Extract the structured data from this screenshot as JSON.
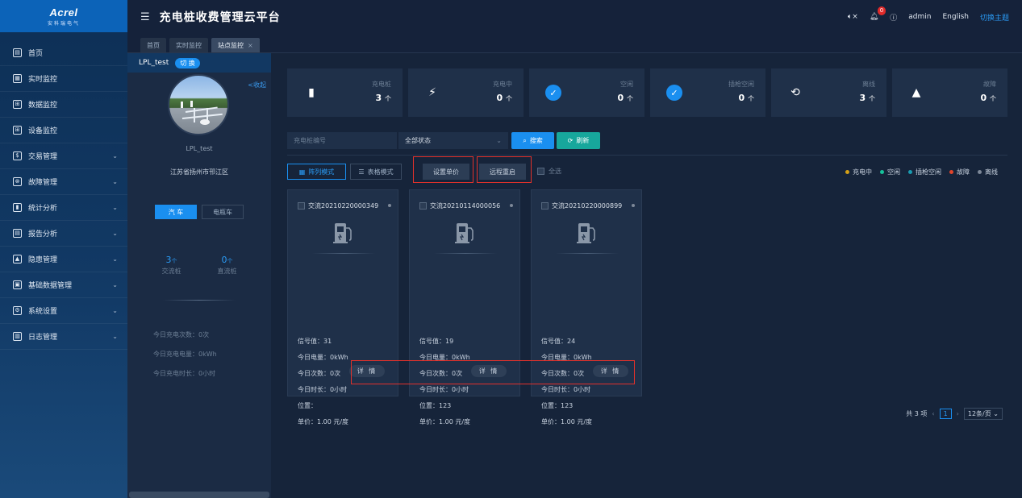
{
  "logo": {
    "brand": "Acrel",
    "sub": "安科瑞电气"
  },
  "sidebar": {
    "items": [
      {
        "label": "首页",
        "icon": "home-icon",
        "glyph": "▤",
        "chev": ""
      },
      {
        "label": "实时监控",
        "icon": "monitor-icon",
        "glyph": "▦",
        "chev": ""
      },
      {
        "label": "数据监控",
        "icon": "data-icon",
        "glyph": "⊞",
        "chev": ""
      },
      {
        "label": "设备监控",
        "icon": "device-icon",
        "glyph": "⊞",
        "chev": ""
      },
      {
        "label": "交易管理",
        "icon": "money-icon",
        "glyph": "$",
        "chev": "⌄"
      },
      {
        "label": "故障管理",
        "icon": "fault-icon",
        "glyph": "⊗",
        "chev": "⌄"
      },
      {
        "label": "统计分析",
        "icon": "stats-icon",
        "glyph": "▮",
        "chev": "⌄"
      },
      {
        "label": "报告分析",
        "icon": "report-icon",
        "glyph": "▤",
        "chev": "⌄"
      },
      {
        "label": "隐患管理",
        "icon": "warning-icon",
        "glyph": "▲",
        "chev": "⌄"
      },
      {
        "label": "基础数据管理",
        "icon": "basedata-icon",
        "glyph": "▣",
        "chev": "⌄"
      },
      {
        "label": "系统设置",
        "icon": "settings-icon",
        "glyph": "⚙",
        "chev": "⌄"
      },
      {
        "label": "日志管理",
        "icon": "log-icon",
        "glyph": "▥",
        "chev": "⌄"
      }
    ]
  },
  "header": {
    "title": "充电桩收费管理云平台",
    "badge_count": "0",
    "user": "admin",
    "language": "English",
    "theme_link": "切换主题"
  },
  "tabs": [
    {
      "label": "首页",
      "active": false
    },
    {
      "label": "实时监控",
      "active": false
    },
    {
      "label": "站点监控",
      "active": true
    }
  ],
  "station": {
    "name": "LPL_test",
    "switch_label": "切 换",
    "collapse_label": "<收起",
    "address": "江苏省扬州市邗江区",
    "vehicle_tabs": [
      "汽 车",
      "电瓶车"
    ],
    "counts": [
      {
        "num": "3",
        "unit": "个",
        "label": "交流桩"
      },
      {
        "num": "0",
        "unit": "个",
        "label": "直流桩"
      }
    ],
    "today_count": "今日充电次数：0次",
    "today_energy": "今日充电电量：0kWh",
    "today_duration": "今日充电时长：0小时"
  },
  "stats": [
    {
      "label": "充电桩",
      "value": "3",
      "unit": "个",
      "icon": "charger-icon"
    },
    {
      "label": "充电中",
      "value": "0",
      "unit": "个",
      "icon": "lightning-icon"
    },
    {
      "label": "空闲",
      "value": "0",
      "unit": "个",
      "icon": "idle-check-icon"
    },
    {
      "label": "插枪空闲",
      "value": "0",
      "unit": "个",
      "icon": "plug-check-icon"
    },
    {
      "label": "离线",
      "value": "3",
      "unit": "个",
      "icon": "offline-plug-icon"
    },
    {
      "label": "故障",
      "value": "0",
      "unit": "个",
      "icon": "fault-warning-icon"
    }
  ],
  "filter": {
    "placeholder": "充电桩编号",
    "status_value": "全部状态",
    "search_label": "搜索",
    "refresh_label": "刷新"
  },
  "actions": {
    "grid_mode": "阵列模式",
    "table_mode": "表格模式",
    "set_price": "设置单价",
    "remote_reboot": "远程重启",
    "select_all": "全选"
  },
  "legend": [
    {
      "label": "充电中",
      "color": "#d4a017"
    },
    {
      "label": "空闲",
      "color": "#17c29b"
    },
    {
      "label": "插枪空闲",
      "color": "#1a9bb0"
    },
    {
      "label": "故障",
      "color": "#e2452b"
    },
    {
      "label": "离线",
      "color": "#7d8898"
    }
  ],
  "cards": [
    {
      "id": "交流20210220000349",
      "signal": "信号值：31",
      "energy": "今日电量：0kWh",
      "times": "今日次数：0次",
      "duration": "今日时长：0小时",
      "location": "位置：",
      "price": "单价：1.00 元/度",
      "detail": "详 情"
    },
    {
      "id": "交流20210114000056",
      "signal": "信号值：19",
      "energy": "今日电量：0kWh",
      "times": "今日次数：0次",
      "duration": "今日时长：0小时",
      "location": "位置：123",
      "price": "单价：1.00 元/度",
      "detail": "详 情"
    },
    {
      "id": "交流20210220000899",
      "signal": "信号值：24",
      "energy": "今日电量：0kWh",
      "times": "今日次数：0次",
      "duration": "今日时长：0小时",
      "location": "位置：123",
      "price": "单价：1.00 元/度",
      "detail": "详 情"
    }
  ],
  "pager": {
    "total": "共 3 项",
    "page": "1",
    "size": "12条/页"
  }
}
